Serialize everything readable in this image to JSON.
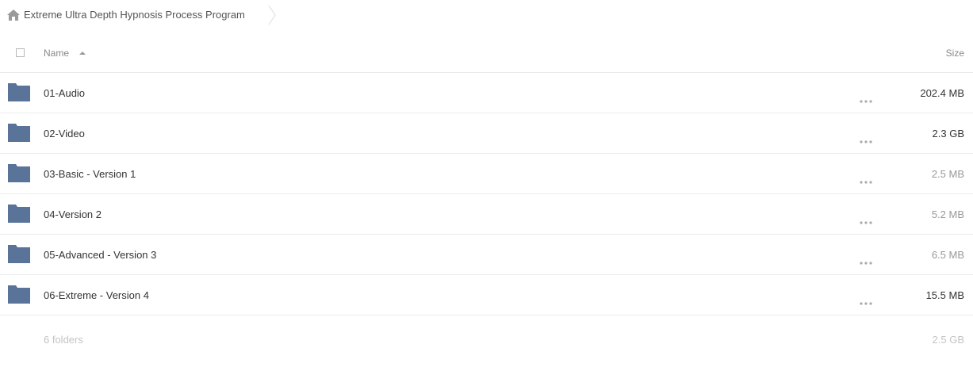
{
  "breadcrumb": {
    "home_icon": "home-icon",
    "title": "Extreme Ultra Depth Hypnosis Process Program"
  },
  "header": {
    "name_label": "Name",
    "size_label": "Size",
    "sort": "ascending"
  },
  "rows": [
    {
      "name": "01-Audio",
      "size": "202.4 MB",
      "size_color": "#333333"
    },
    {
      "name": "02-Video",
      "size": "2.3 GB",
      "size_color": "#333333"
    },
    {
      "name": "03-Basic - Version 1",
      "size": "2.5 MB",
      "size_color": "#999999"
    },
    {
      "name": "04-Version 2",
      "size": "5.2 MB",
      "size_color": "#999999"
    },
    {
      "name": "05-Advanced - Version 3",
      "size": "6.5 MB",
      "size_color": "#999999"
    },
    {
      "name": "06-Extreme - Version 4",
      "size": "15.5 MB",
      "size_color": "#333333"
    }
  ],
  "footer": {
    "count": "6 folders",
    "total": "2.5 GB"
  },
  "colors": {
    "folder": "#5a7499",
    "home": "#9a9a9a",
    "more": "#aaaaaa"
  }
}
